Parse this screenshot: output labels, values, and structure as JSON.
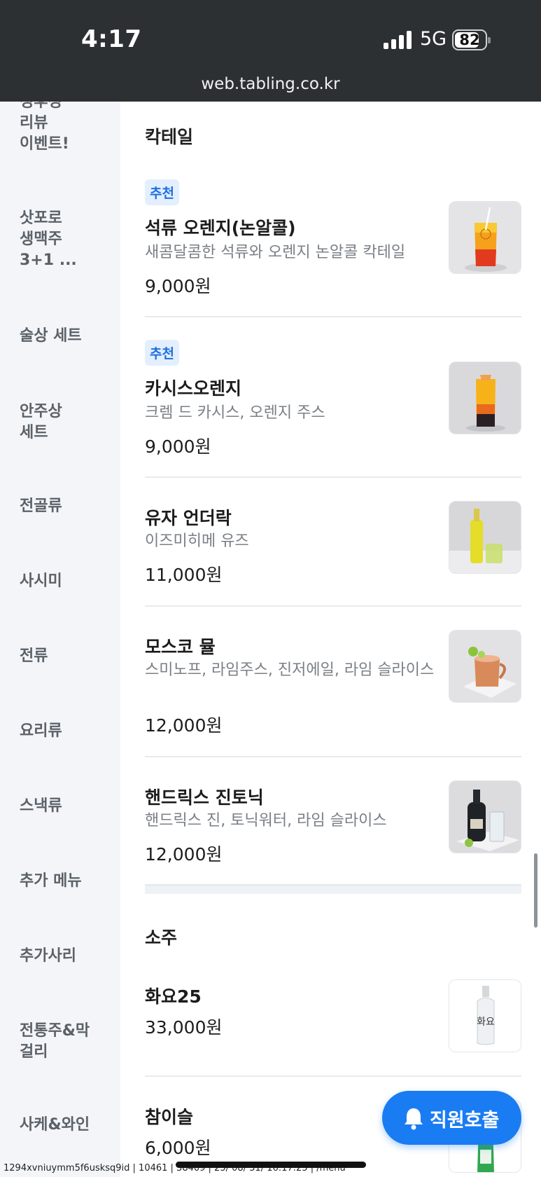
{
  "status_bar": {
    "time": "4:17",
    "network": "5G",
    "battery": "82",
    "battery_level": 0.82,
    "url": "web.tabling.co.kr"
  },
  "sidebar": {
    "items": [
      {
        "label": "정후정\n리뷰\n이벤트!"
      },
      {
        "label": "삿포로\n생맥주\n3+1 ..."
      },
      {
        "label": "술상 세트"
      },
      {
        "label": "안주상\n세트"
      },
      {
        "label": "전골류"
      },
      {
        "label": "사시미"
      },
      {
        "label": "전류"
      },
      {
        "label": "요리류"
      },
      {
        "label": "스낵류"
      },
      {
        "label": "추가 메뉴"
      },
      {
        "label": "추가사리"
      },
      {
        "label": "전통주&막\n걸리"
      },
      {
        "label": "사케&와인"
      }
    ]
  },
  "sections": [
    {
      "title": "칵테일",
      "items": [
        {
          "badge": "추천",
          "name": "석류 오렌지(논알콜)",
          "desc": "새콤달콤한 석류와 오렌지 논알콜 칵테일",
          "price": "9,000원",
          "image": "pomegranate-orange-drink"
        },
        {
          "badge": "추천",
          "name": "카시스오렌지",
          "desc": "크렘 드 카시스, 오렌지 주스",
          "price": "9,000원",
          "image": "cassis-orange-drink"
        },
        {
          "name": "유자 언더락",
          "desc": "이즈미히메 유즈",
          "price": "11,000원",
          "image": "yuzu-liqueur-drink"
        },
        {
          "name": "모스코 뮬",
          "desc": "스미노프, 라임주스, 진저에일, 라임 슬라이스",
          "price": "12,000원",
          "image": "moscow-mule-mug"
        },
        {
          "name": "핸드릭스 진토닉",
          "desc": "핸드릭스 진, 토닉워터, 라임 슬라이스",
          "price": "12,000원",
          "image": "hendricks-gin-tonic"
        }
      ]
    },
    {
      "title": "소주",
      "items": [
        {
          "name": "화요25",
          "price": "33,000원",
          "image": "hwayo-bottle"
        },
        {
          "name": "참이슬",
          "price": "6,000원",
          "image": "chamisul-bottle"
        }
      ]
    }
  ],
  "call_button": {
    "label": "직원호출",
    "icon": "bell-icon"
  },
  "debug_text": "1294xvniuymm5f6usksq9id | 10461 | 38409 | 25/ 08/ 31/ 16:17:25 | /menu"
}
